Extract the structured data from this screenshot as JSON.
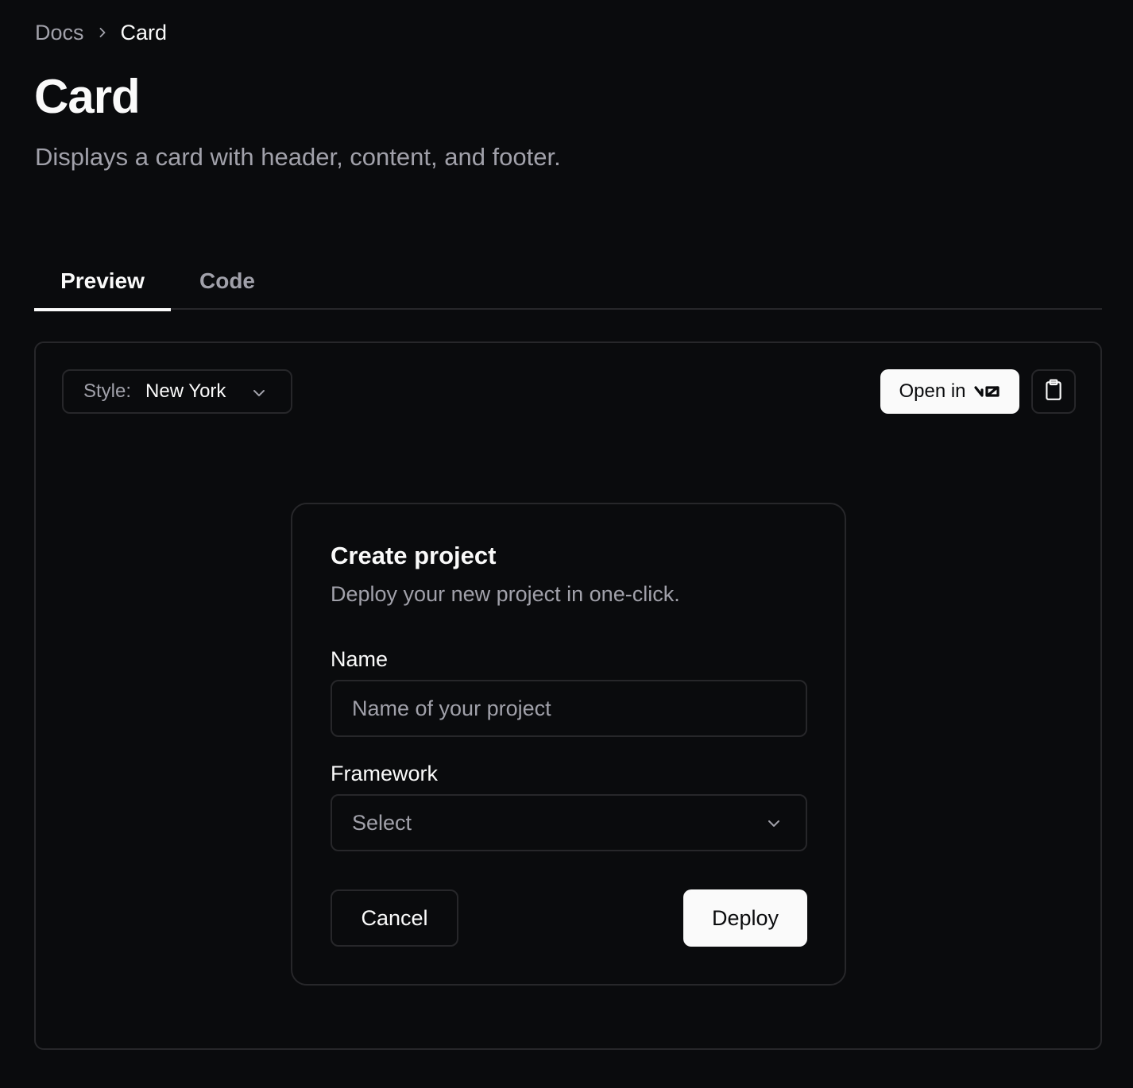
{
  "breadcrumb": {
    "parent": "Docs",
    "current": "Card"
  },
  "page": {
    "title": "Card",
    "description": "Displays a card with header, content, and footer."
  },
  "tabs": [
    {
      "label": "Preview",
      "active": true
    },
    {
      "label": "Code",
      "active": false
    }
  ],
  "toolbar": {
    "style_label": "Style:",
    "style_value": "New York",
    "open_in_label": "Open in",
    "open_in_logo": "v0-logo",
    "copy_icon": "clipboard-icon"
  },
  "card": {
    "title": "Create project",
    "description": "Deploy your new project in one-click.",
    "name_label": "Name",
    "name_placeholder": "Name of your project",
    "name_value": "",
    "framework_label": "Framework",
    "framework_value": "Select",
    "cancel_label": "Cancel",
    "deploy_label": "Deploy"
  },
  "colors": {
    "background": "#0a0b0d",
    "foreground": "#fafafa",
    "muted": "#a1a1aa",
    "border": "#27272a"
  }
}
